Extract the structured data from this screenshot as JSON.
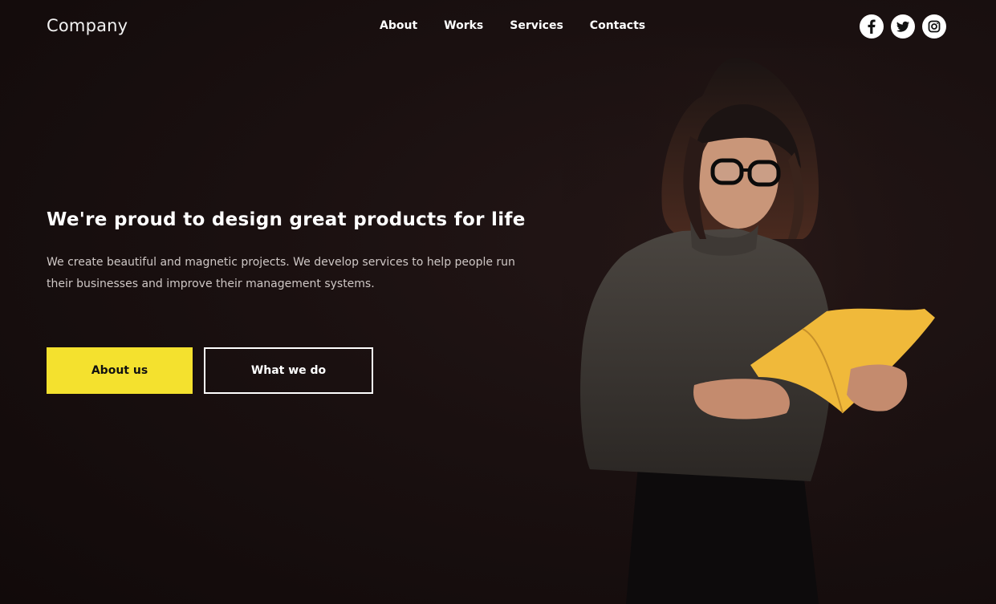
{
  "brand": {
    "logo": "Company"
  },
  "nav": {
    "items": [
      {
        "label": "About"
      },
      {
        "label": "Works"
      },
      {
        "label": "Services"
      },
      {
        "label": "Contacts"
      }
    ]
  },
  "social": [
    {
      "icon": "facebook-icon"
    },
    {
      "icon": "twitter-icon"
    },
    {
      "icon": "instagram-icon"
    }
  ],
  "hero": {
    "headline": "We're proud to design great products for life",
    "description": "We create beautiful and magnetic projects. We develop services to help people run their businesses and improve their management systems.",
    "primary_button": "About us",
    "secondary_button": "What we do"
  },
  "colors": {
    "background": "#1a1010",
    "accent": "#f4e12e",
    "text": "#ffffff"
  }
}
